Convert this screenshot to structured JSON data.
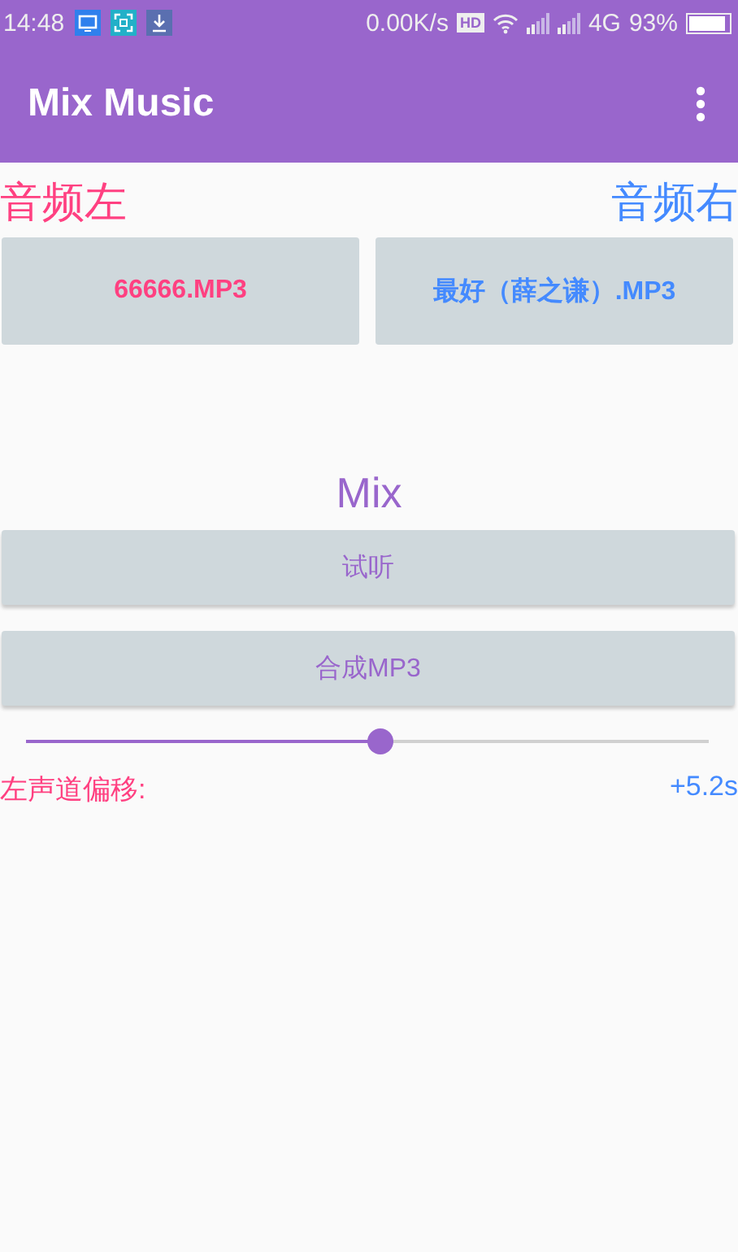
{
  "status_bar": {
    "time": "14:48",
    "speed": "0.00K/s",
    "hd": "HD",
    "network": "4G",
    "battery": "93%"
  },
  "app_bar": {
    "title": "Mix Music"
  },
  "labels": {
    "left": "音频左",
    "right": "音频右"
  },
  "files": [
    {
      "label": "66666.MP3",
      "color": "#ff4081"
    },
    {
      "label": "最好（薛之谦）.MP3",
      "color": "#448aff"
    }
  ],
  "mix_title": "Mix",
  "actions": [
    "试听",
    "合成MP3"
  ],
  "offset": {
    "level": 0.52,
    "label": "左声道偏移:",
    "reading": "+5.2s"
  }
}
